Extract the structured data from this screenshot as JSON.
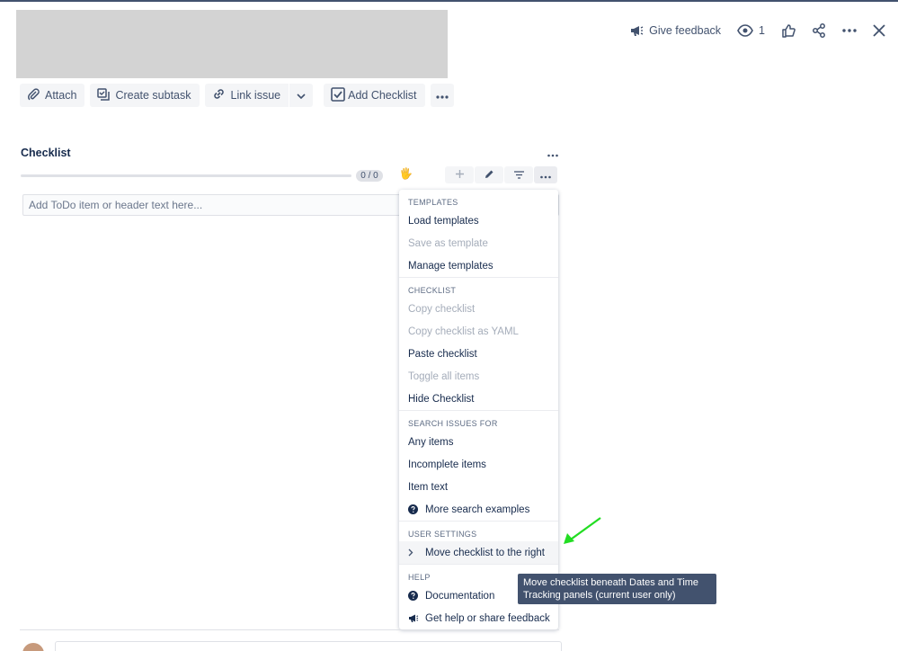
{
  "topbar": {
    "feedback_label": "Give feedback",
    "watch_count": "1",
    "icons": [
      "megaphone-icon",
      "eye-icon",
      "thumbs-up-icon",
      "share-icon",
      "more-icon",
      "close-icon"
    ]
  },
  "toolbar": {
    "attach_label": "Attach",
    "create_subtask_label": "Create subtask",
    "link_issue_label": "Link issue",
    "add_checklist_label": "Add Checklist"
  },
  "checklist": {
    "title": "Checklist",
    "progress_text": "0 / 0",
    "progress_fraction": 0,
    "input_placeholder": "Add ToDo item or header text here..."
  },
  "menu": {
    "sections": [
      {
        "header": "TEMPLATES",
        "items": [
          {
            "label": "Load templates",
            "disabled": false
          },
          {
            "label": "Save as template",
            "disabled": true
          },
          {
            "label": "Manage templates",
            "disabled": false
          }
        ]
      },
      {
        "header": "CHECKLIST",
        "items": [
          {
            "label": "Copy checklist",
            "disabled": true
          },
          {
            "label": "Copy checklist as YAML",
            "disabled": true
          },
          {
            "label": "Paste checklist",
            "disabled": false
          },
          {
            "label": "Toggle all items",
            "disabled": true
          },
          {
            "label": "Hide Checklist",
            "disabled": false
          }
        ]
      },
      {
        "header": "SEARCH ISSUES FOR",
        "items": [
          {
            "label": "Any items",
            "disabled": false
          },
          {
            "label": "Incomplete items",
            "disabled": false
          },
          {
            "label": "Item text",
            "disabled": false
          },
          {
            "label": "More search examples",
            "disabled": false,
            "icon": "help-icon"
          }
        ]
      },
      {
        "header": "USER SETTINGS",
        "items": [
          {
            "label": "Move checklist to the right",
            "disabled": false,
            "icon": "chevron-right-icon",
            "highlight": true
          }
        ]
      },
      {
        "header": "HELP",
        "items": [
          {
            "label": "Documentation",
            "disabled": false,
            "icon": "help-icon"
          },
          {
            "label": "Get help or share feedback",
            "disabled": false,
            "icon": "megaphone-icon"
          }
        ]
      }
    ]
  },
  "tooltip": {
    "text": "Move checklist beneath Dates and Time Tracking panels (current user only)"
  },
  "colors": {
    "arrow": "#22dd22",
    "tooltip_bg": "#42526e",
    "button_bg": "#f4f5f7"
  }
}
